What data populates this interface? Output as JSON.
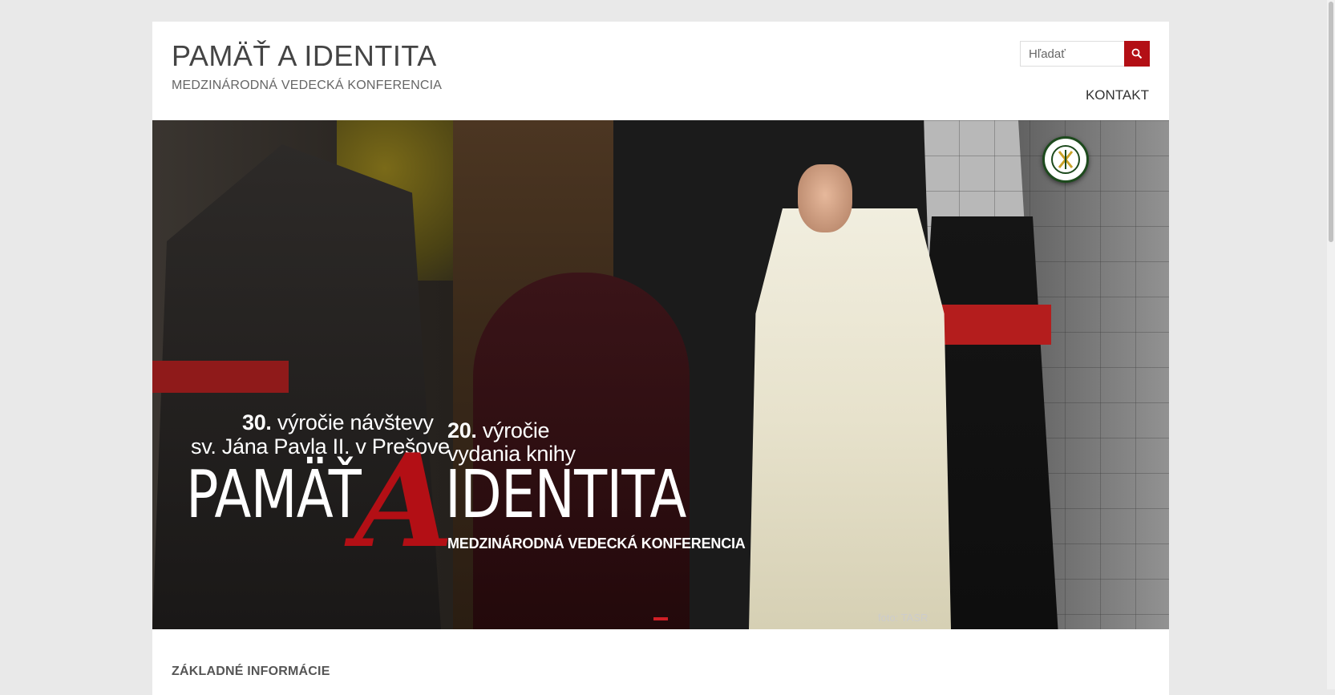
{
  "header": {
    "site_title": "PAMÄŤ A IDENTITA",
    "site_subtitle": "MEDZINÁRODNÁ VEDECKÁ KONFERENCIA",
    "search_placeholder": "Hľadať",
    "nav_contact": "KONTAKT"
  },
  "hero": {
    "line1_num": "30.",
    "line1_text": " výročie návštevy",
    "line2": "sv. Jána Pavla II. v Prešove",
    "line3_num": "20.",
    "line3_text": " výročie",
    "line4": "vydania knihy",
    "title_left": "PAMÄŤ",
    "title_A": "A",
    "title_right": "IDENTITA",
    "conference": "MEDZINÁRODNÁ VEDECKÁ KONFERENCIA",
    "credit": "foto: TASR"
  },
  "main": {
    "section_title": "ZÁKLADNÉ INFORMÁCIE"
  },
  "colors": {
    "accent": "#b30f15",
    "slider_dot": "#d01f26"
  },
  "icons": {
    "search": "magnifier-icon",
    "logo": "chi-rho-badge"
  }
}
